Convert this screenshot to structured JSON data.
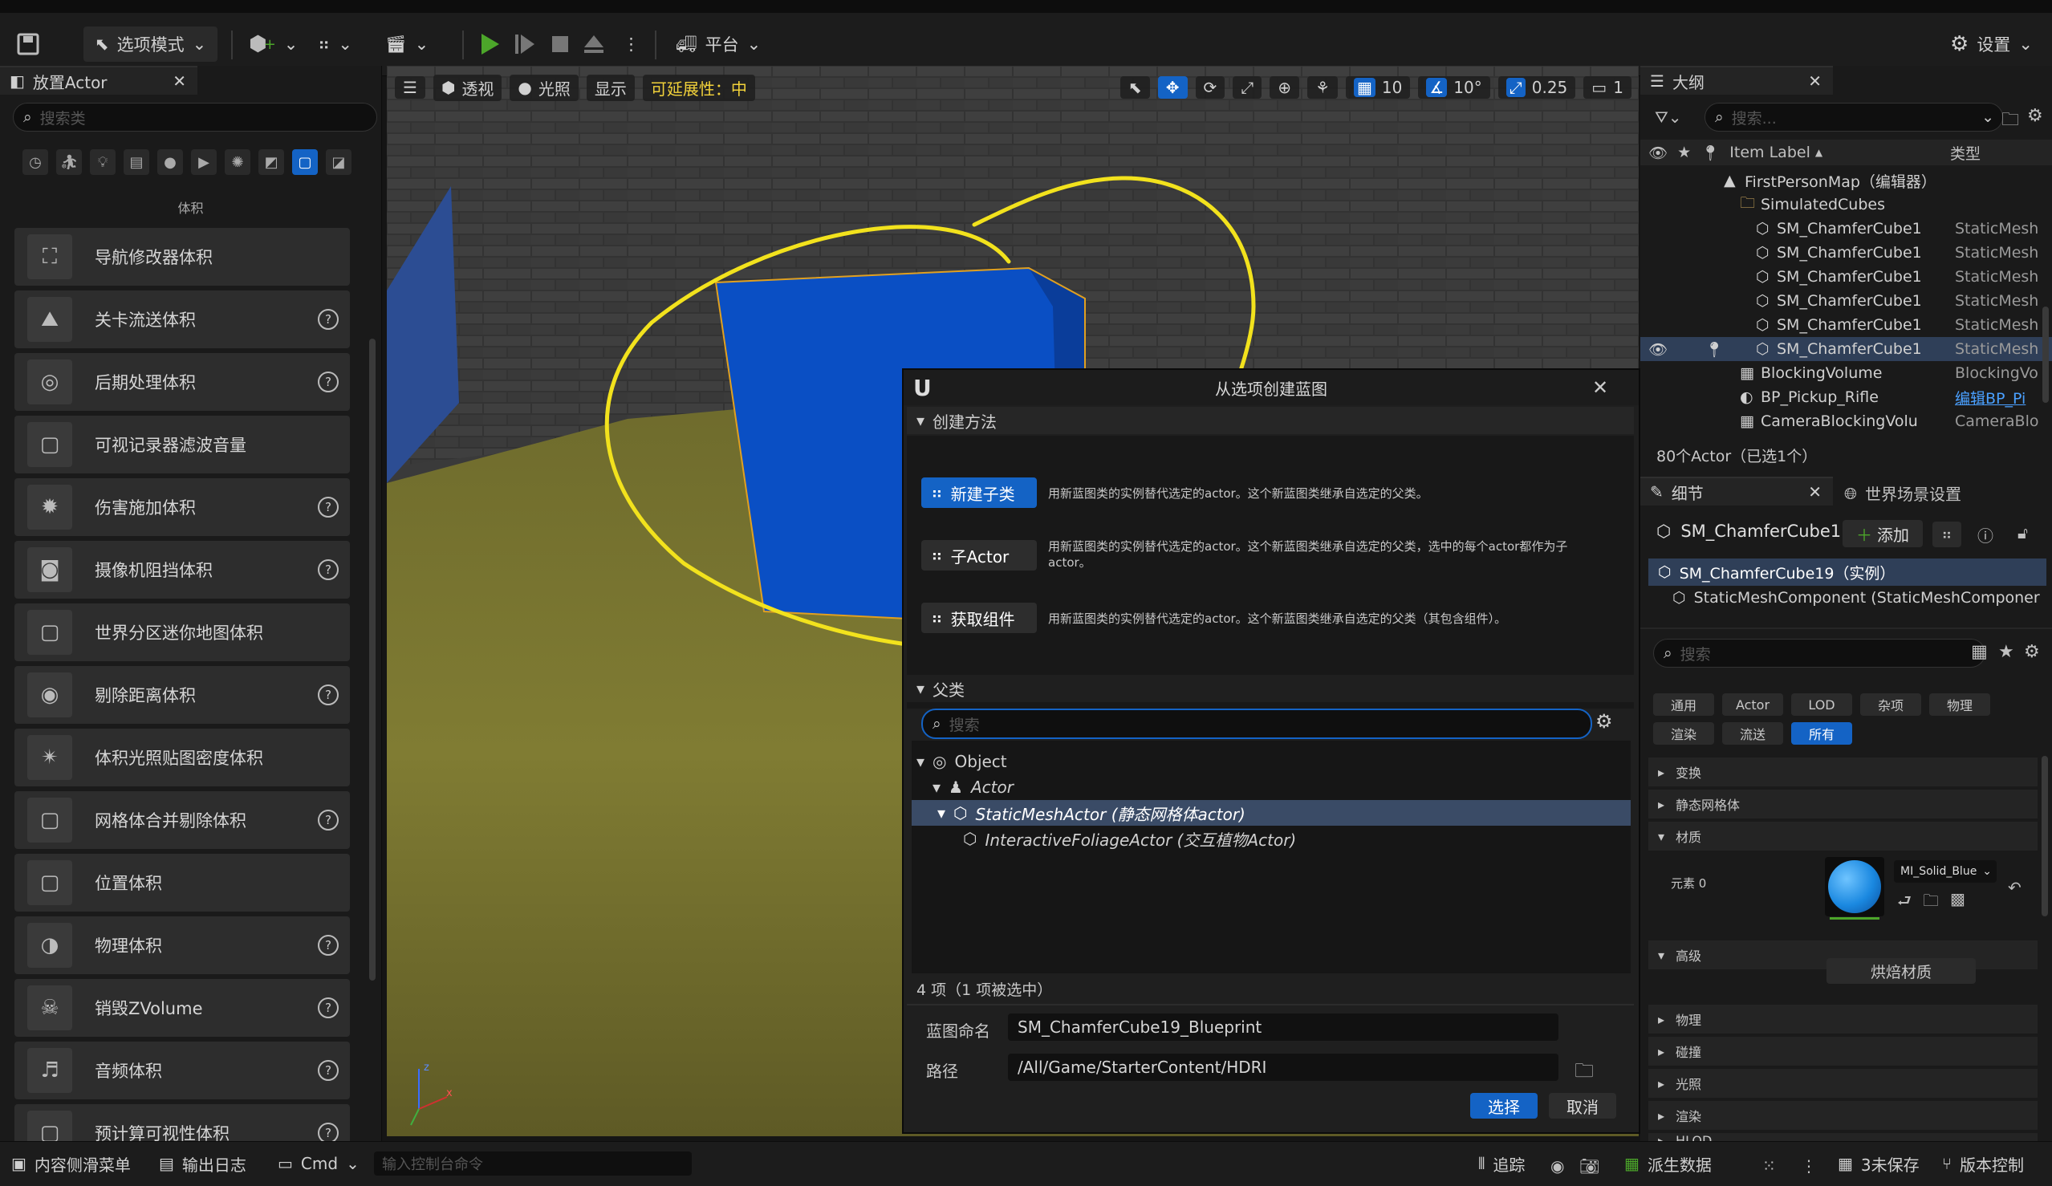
{
  "toolbar": {
    "mode_label": "选项模式",
    "platform_label": "平台",
    "settings_label": "设置"
  },
  "place_actor": {
    "tab_title": "放置Actor",
    "search_placeholder": "搜索类",
    "category_label": "体积",
    "items": [
      {
        "label": "导航修改器体积",
        "help": false
      },
      {
        "label": "关卡流送体积",
        "help": true
      },
      {
        "label": "后期处理体积",
        "help": true
      },
      {
        "label": "可视记录器滤波音量",
        "help": false
      },
      {
        "label": "伤害施加体积",
        "help": true
      },
      {
        "label": "摄像机阻挡体积",
        "help": true
      },
      {
        "label": "世界分区迷你地图体积",
        "help": false
      },
      {
        "label": "剔除距离体积",
        "help": true
      },
      {
        "label": "体积光照贴图密度体积",
        "help": false
      },
      {
        "label": "网格体合并剔除体积",
        "help": true
      },
      {
        "label": "位置体积",
        "help": false
      },
      {
        "label": "物理体积",
        "help": true
      },
      {
        "label": "销毁ZVolume",
        "help": true
      },
      {
        "label": "音频体积",
        "help": true
      },
      {
        "label": "预计算可视性体积",
        "help": true
      }
    ]
  },
  "viewport": {
    "perspective_label": "透视",
    "lighting_label": "光照",
    "show_label": "显示",
    "scalability_label": "可延展性：中",
    "grid_value": "10",
    "rotation_value": "10°",
    "scale_value": "0.25",
    "camera_speed": "1"
  },
  "dialog": {
    "title": "从选项创建蓝图",
    "method_section": "创建方法",
    "methods": [
      {
        "label": "新建子类",
        "desc": "用新蓝图类的实例替代选定的actor。这个新蓝图类继承自选定的父类。"
      },
      {
        "label": "子Actor",
        "desc": "用新蓝图类的实例替代选定的actor。这个新蓝图类继承自选定的父类，选中的每个actor都作为子actor。"
      },
      {
        "label": "获取组件",
        "desc": "用新蓝图类的实例替代选定的actor。这个新蓝图类继承自选定的父类（其包含组件）。"
      }
    ],
    "parent_section": "父类",
    "search_placeholder": "搜索",
    "tree": [
      {
        "label": "Object"
      },
      {
        "label": "Actor"
      },
      {
        "label": "StaticMeshActor (静态网格体actor)"
      },
      {
        "label": "InteractiveFoliageActor (交互植物Actor)"
      }
    ],
    "count_text": "4 项（1 项被选中）",
    "name_label": "蓝图命名",
    "name_value": "SM_ChamferCube19_Blueprint",
    "path_label": "路径",
    "path_value": "/All/Game/StarterContent/HDRI",
    "select_button": "选择",
    "cancel_button": "取消"
  },
  "outliner": {
    "tab_title": "大纲",
    "search_placeholder": "搜索...",
    "col_label": "Item Label",
    "col_type": "类型",
    "rows": [
      {
        "label": "FirstPersonMap（编辑器）",
        "type": ""
      },
      {
        "label": "SimulatedCubes",
        "type": ""
      },
      {
        "label": "SM_ChamferCube1",
        "type": "StaticMesh"
      },
      {
        "label": "SM_ChamferCube1",
        "type": "StaticMesh"
      },
      {
        "label": "SM_ChamferCube1",
        "type": "StaticMesh"
      },
      {
        "label": "SM_ChamferCube1",
        "type": "StaticMesh"
      },
      {
        "label": "SM_ChamferCube1",
        "type": "StaticMesh"
      },
      {
        "label": "SM_ChamferCube1",
        "type": "StaticMesh"
      },
      {
        "label": "BlockingVolume",
        "type": "BlockingVo"
      },
      {
        "label": "BP_Pickup_Rifle",
        "type": "编辑BP_Pi"
      },
      {
        "label": "CameraBlockingVolu",
        "type": "CameraBlo"
      }
    ],
    "footer": "80个Actor（已选1个）"
  },
  "details": {
    "tab_title": "细节",
    "world_tab": "世界场景设置",
    "actor_name": "SM_ChamferCube1",
    "add_label": "添加",
    "instance_label": "SM_ChamferCube19（实例）",
    "component_label": "StaticMeshComponent (StaticMeshComponer",
    "search_placeholder": "搜索",
    "filters_row1": [
      "通用",
      "Actor",
      "LOD",
      "杂项",
      "物理"
    ],
    "filters_row2": [
      "渲染",
      "流送",
      "所有"
    ],
    "sections": {
      "transform": "变换",
      "static_mesh": "静态网格体",
      "materials": "材质",
      "element0": "元素 0",
      "material_value": "MI_Solid_Blue",
      "advanced": "高级",
      "bake_button": "烘焙材质",
      "physics": "物理",
      "collision": "碰撞",
      "lighting": "光照",
      "rendering": "渲染",
      "hlod": "HLOD"
    }
  },
  "statusbar": {
    "content_drawer": "内容侧滑菜单",
    "output_log": "输出日志",
    "cmd": "Cmd",
    "console_placeholder": "输入控制台命令",
    "trace": "追踪",
    "derived_data": "派生数据",
    "unsaved": "3未保存",
    "source_control": "版本控制"
  },
  "colors": {
    "accent": "#1463c5",
    "annotation": "#f2e21d",
    "cube": "#0a4fc4",
    "play": "#4ca62a"
  }
}
